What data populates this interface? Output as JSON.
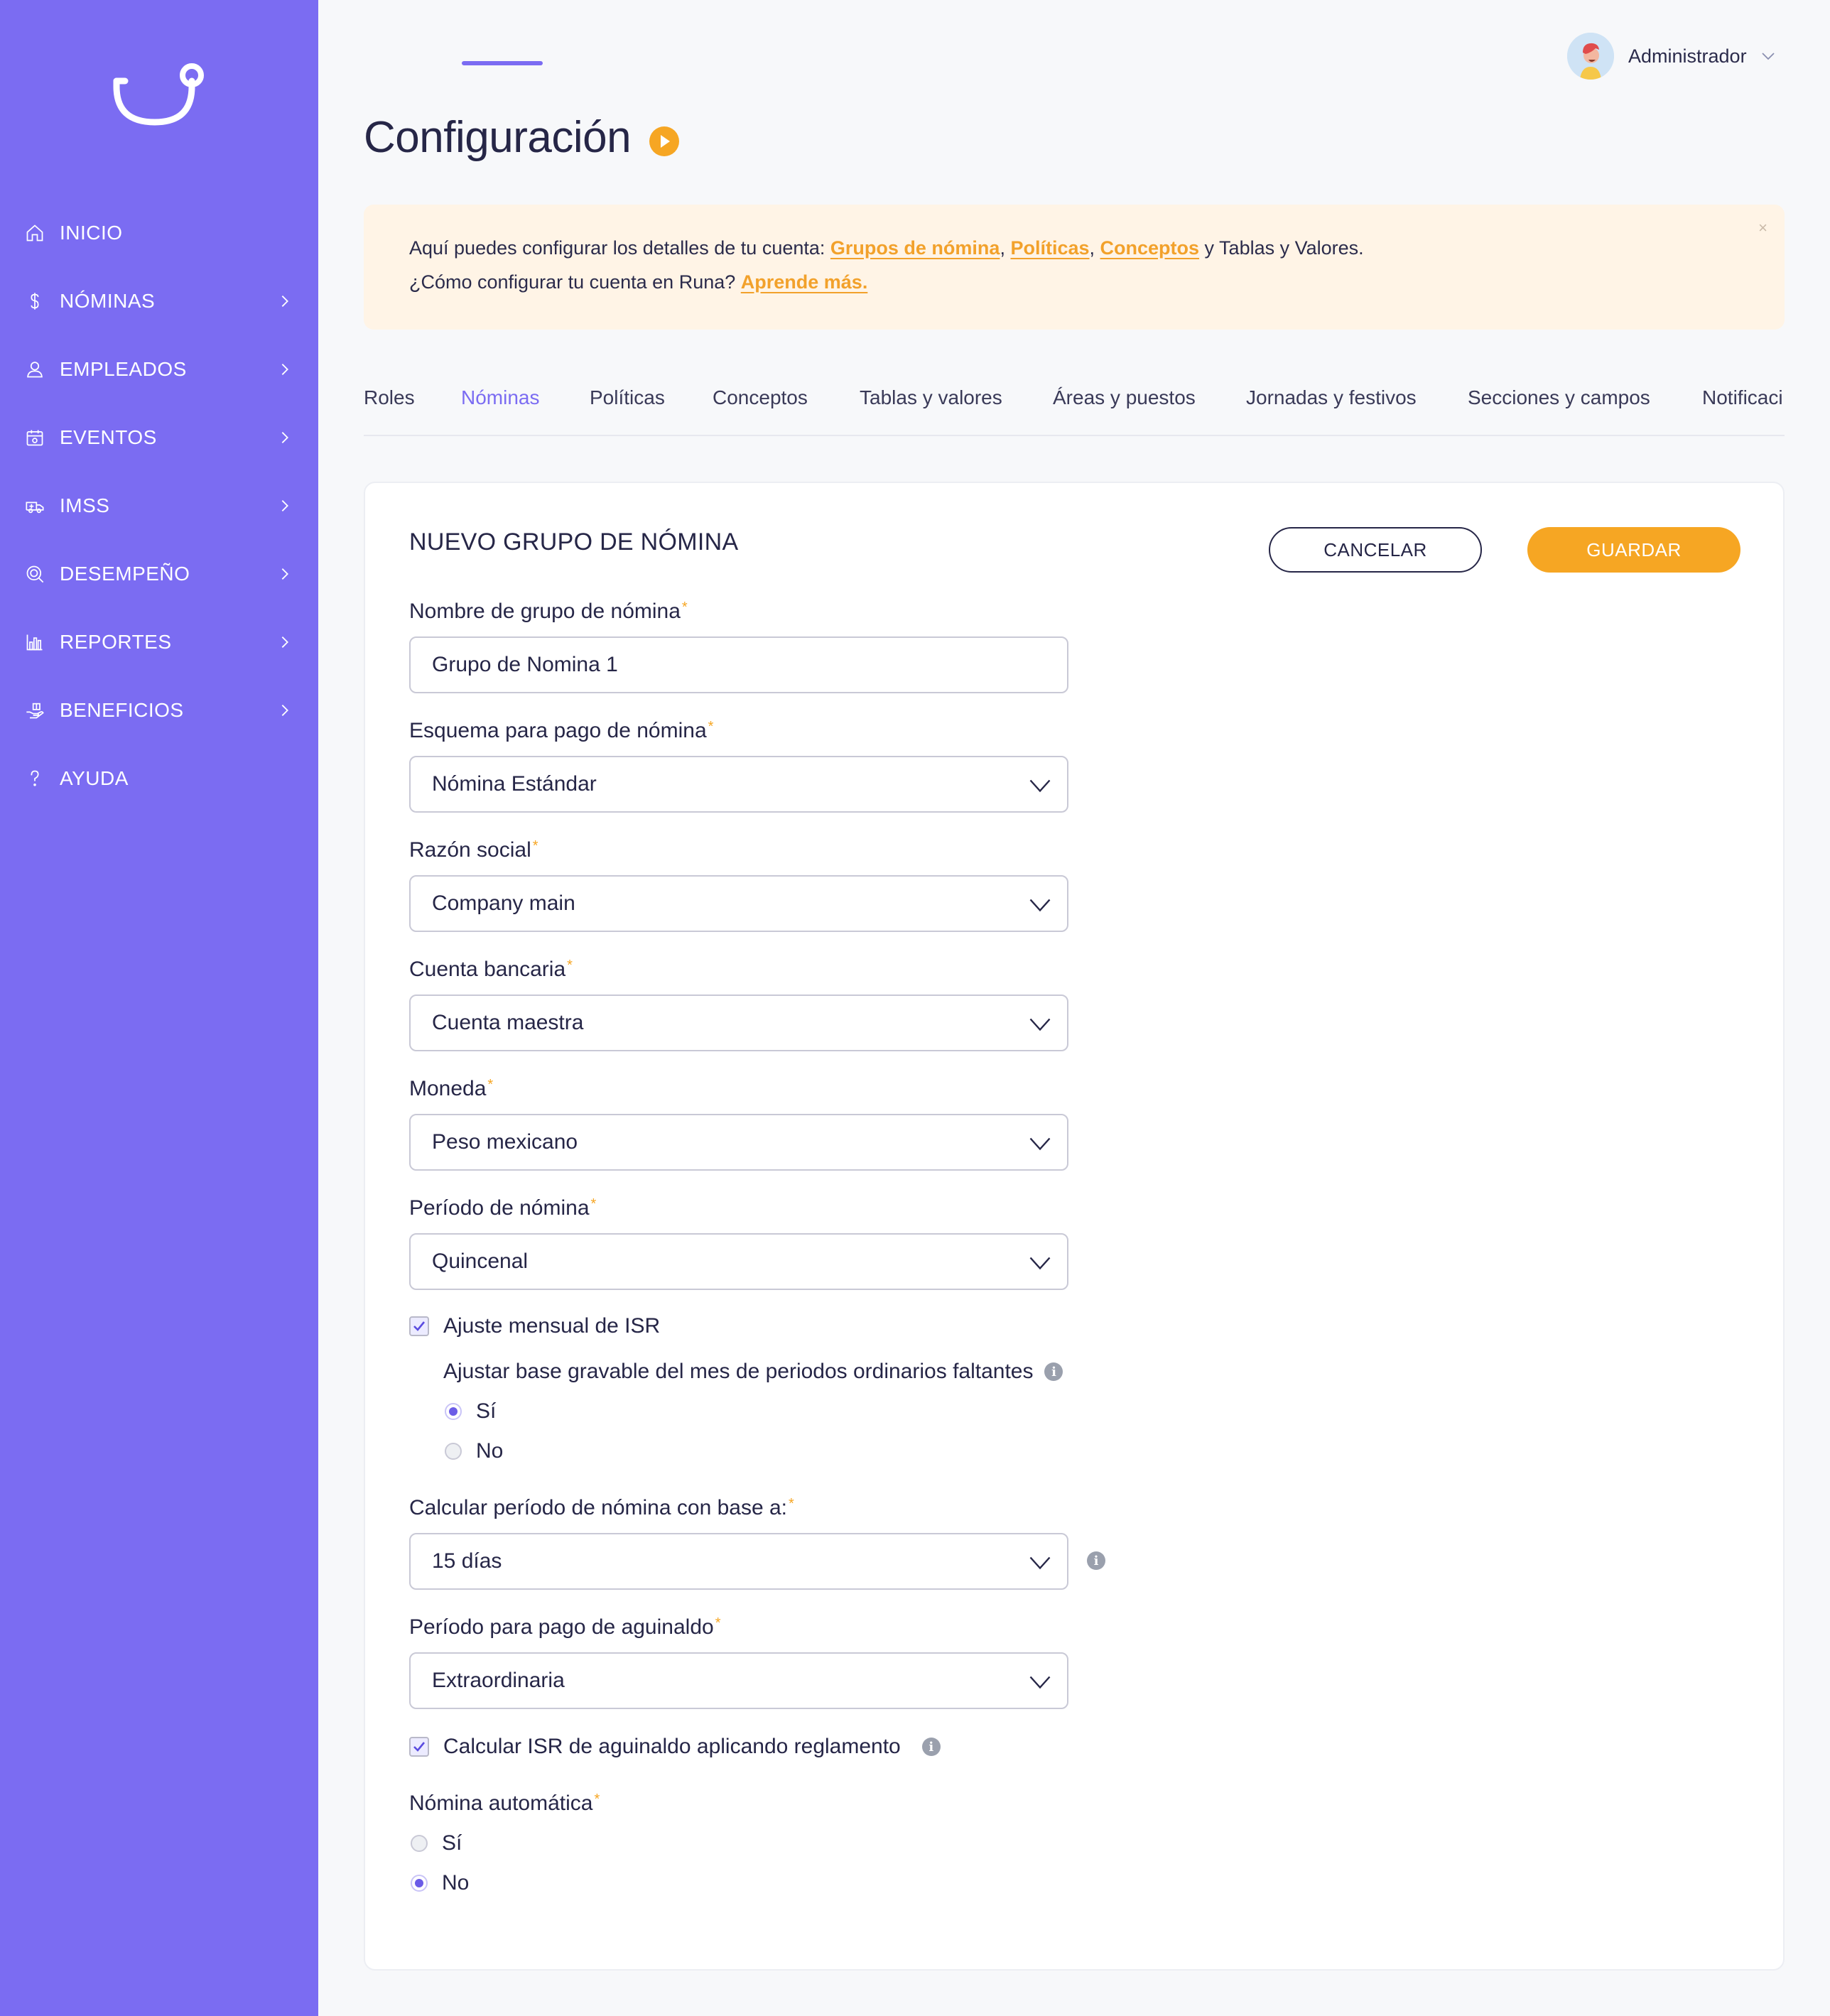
{
  "sidebar": {
    "items": [
      {
        "label": "INICIO",
        "icon": "home-icon",
        "chevron": false
      },
      {
        "label": "NÓMINAS",
        "icon": "dollar-icon",
        "chevron": true
      },
      {
        "label": "EMPLEADOS",
        "icon": "user-icon",
        "chevron": true
      },
      {
        "label": "EVENTOS",
        "icon": "calendar-icon",
        "chevron": true
      },
      {
        "label": "IMSS",
        "icon": "ambulance-icon",
        "chevron": true
      },
      {
        "label": "DESEMPEÑO",
        "icon": "target-search-icon",
        "chevron": true
      },
      {
        "label": "REPORTES",
        "icon": "bar-chart-icon",
        "chevron": true
      },
      {
        "label": "BENEFICIOS",
        "icon": "hand-gift-icon",
        "chevron": true
      },
      {
        "label": "AYUDA",
        "icon": "question-icon",
        "chevron": false
      }
    ]
  },
  "header": {
    "user_name": "Administrador"
  },
  "page": {
    "title": "Configuración"
  },
  "banner": {
    "line1_prefix": "Aquí puedes configurar los detalles de tu cuenta: ",
    "link_grupos": "Grupos de nómina",
    "sep1": ", ",
    "link_politicas": "Políticas",
    "sep2": ", ",
    "link_conceptos": "Conceptos",
    "line1_suffix": " y Tablas y Valores.",
    "line2_prefix": "¿Cómo configurar tu cuenta en Runa? ",
    "link_aprende": "Aprende más.",
    "close": "×"
  },
  "tabs": [
    {
      "label": "Roles"
    },
    {
      "label": "Nóminas"
    },
    {
      "label": "Políticas"
    },
    {
      "label": "Conceptos"
    },
    {
      "label": "Tablas y valores"
    },
    {
      "label": "Áreas y puestos"
    },
    {
      "label": "Jornadas y festivos"
    },
    {
      "label": "Secciones y campos"
    },
    {
      "label": "Notificaci"
    }
  ],
  "form": {
    "title": "NUEVO GRUPO DE NÓMINA",
    "cancel_label": "CANCELAR",
    "save_label": "GUARDAR",
    "required_mark": "*",
    "nombre_label": "Nombre de grupo de nómina",
    "nombre_value": "Grupo de Nomina 1",
    "esquema_label": "Esquema para pago de nómina",
    "esquema_value": "Nómina Estándar",
    "razon_label": "Razón social",
    "razon_value": "Company main",
    "cuenta_label": "Cuenta bancaria",
    "cuenta_value": "Cuenta maestra",
    "moneda_label": "Moneda",
    "moneda_value": "Peso mexicano",
    "periodo_label": "Período de nómina",
    "periodo_value": "Quincenal",
    "ajuste_isr_label": "Ajuste mensual de ISR",
    "ajuste_isr_checked": true,
    "ajustar_base_label": "Ajustar base gravable del mes de periodos ordinarios faltantes",
    "ajustar_base_yes": "Sí",
    "ajustar_base_no": "No",
    "ajustar_base_selected": "Sí",
    "calcular_label": "Calcular período de nómina con base a:",
    "calcular_value": "15 días",
    "aguinaldo_label": "Período para pago de aguinaldo",
    "aguinaldo_value": "Extraordinaria",
    "isr_aguinaldo_label": "Calcular ISR de aguinaldo aplicando reglamento",
    "isr_aguinaldo_checked": true,
    "automatica_label": "Nómina automática",
    "automatica_yes": "Sí",
    "automatica_no": "No",
    "automatica_selected": "No",
    "info_glyph": "i"
  },
  "colors": {
    "sidebar_bg": "#7b6cf2",
    "accent": "#f6a623",
    "active_tab": "#7b6cf2",
    "banner_bg": "#fff4e6"
  }
}
